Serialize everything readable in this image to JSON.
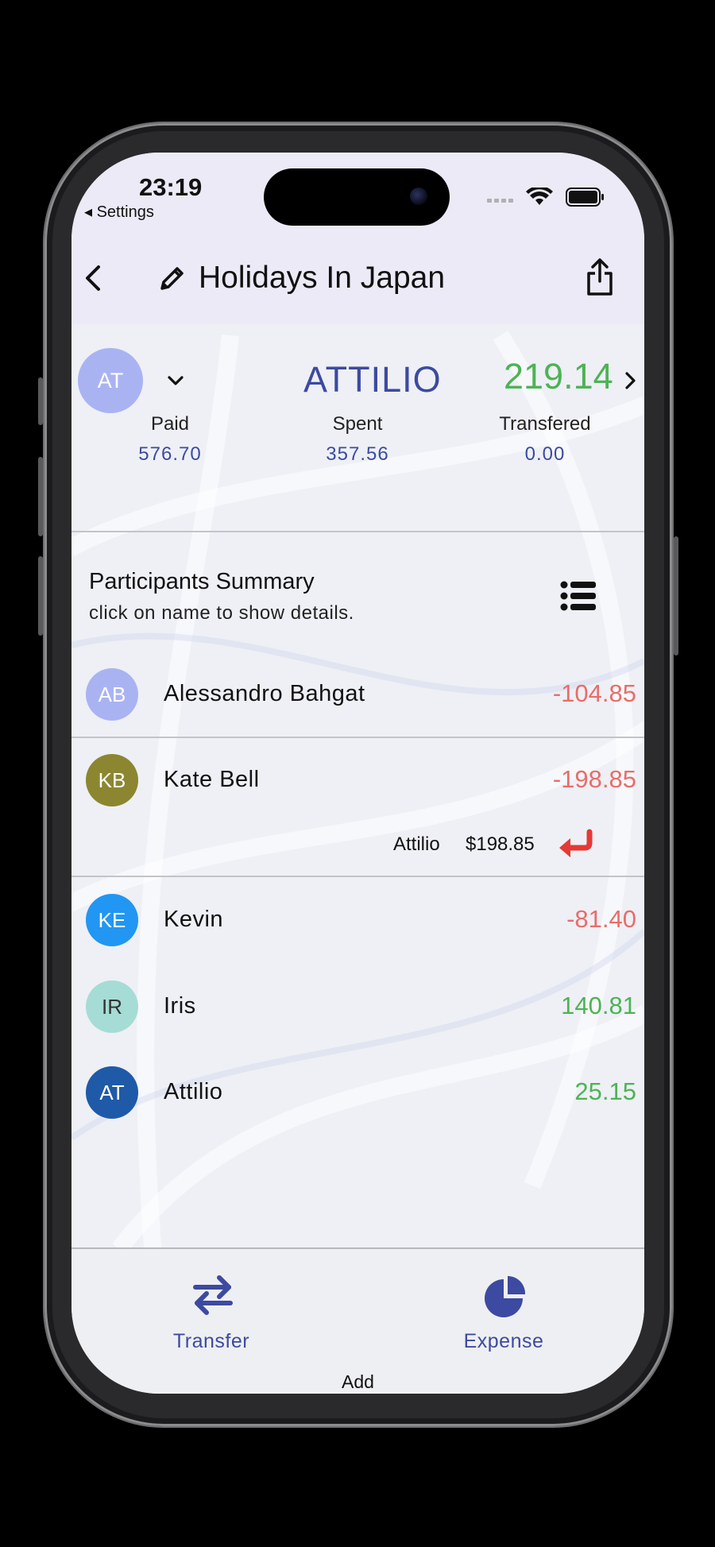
{
  "status": {
    "time": "23:19",
    "back_label": "◂ Settings"
  },
  "header": {
    "title": "Holidays In Japan"
  },
  "user": {
    "initials": "AT",
    "name": "ATTILIO",
    "balance": "219.14",
    "stats": [
      {
        "label": "Paid",
        "value": "576.70"
      },
      {
        "label": "Spent",
        "value": "357.56"
      },
      {
        "label": "Transfered",
        "value": "0.00"
      }
    ]
  },
  "summary": {
    "title": "Participants Summary",
    "subtitle": "click on name to show details."
  },
  "participants": [
    {
      "initials": "AB",
      "name": "Alessandro Bahgat",
      "value": "-104.85",
      "color": "#aab3f2"
    },
    {
      "initials": "KB",
      "name": "Kate Bell",
      "value": "-198.85",
      "color": "#8c8630"
    },
    {
      "initials": "KE",
      "name": "Kevin",
      "value": "-81.40",
      "color": "#2196f3"
    },
    {
      "initials": "IR",
      "name": "Iris",
      "value": "140.81",
      "color": "#a6dcd6"
    },
    {
      "initials": "AT",
      "name": "Attilio",
      "value": "25.15",
      "color": "#1e5aa8"
    }
  ],
  "debt_detail": {
    "to": "Attilio",
    "amount": "$198.85"
  },
  "footer": {
    "transfer_label": "Transfer",
    "expense_label": "Expense",
    "add_label": "Add"
  },
  "colors": {
    "accent": "#3c4aa1",
    "positive": "#4db354",
    "negative": "#e86d6a",
    "header_bg": "#ebeaf6"
  }
}
